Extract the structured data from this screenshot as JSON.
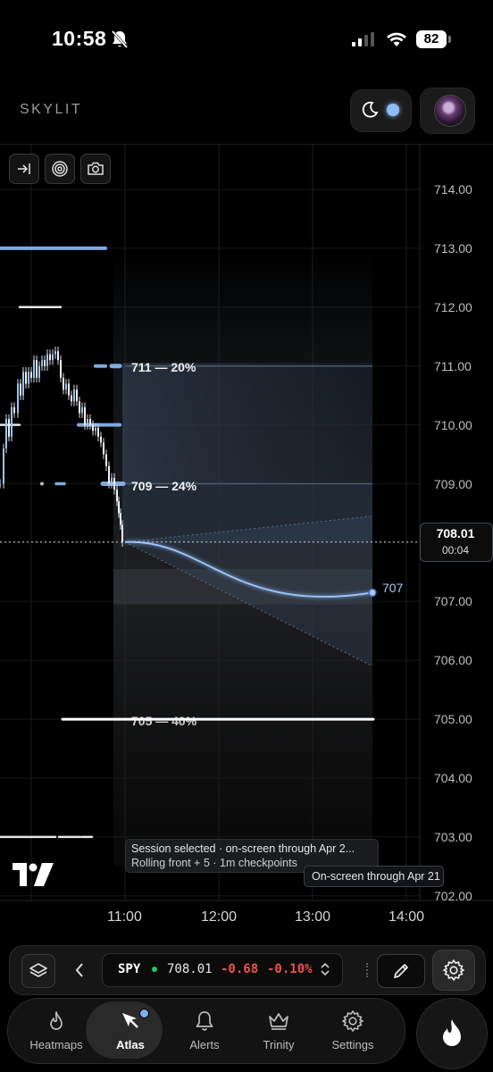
{
  "status_bar": {
    "time": "10:58",
    "battery": "82"
  },
  "header": {
    "brand": "SKYLIT"
  },
  "colors": {
    "accent": "#8ebcf5",
    "negative": "#ef5350",
    "live": "#22c55e"
  },
  "icons": [
    "bell-slash-icon",
    "signal-icon",
    "wifi-icon",
    "moon-icon",
    "jump-to-end-icon",
    "target-icon",
    "camera-icon",
    "tradingview-logo",
    "layers-icon",
    "chevron-left-icon",
    "up-down-chevron-icon",
    "pencil-icon",
    "gear-icon",
    "flame-icon",
    "atlas-icon",
    "bell-icon",
    "crown-icon"
  ],
  "chart": {
    "y_labels": [
      "714.00",
      "713.00",
      "712.00",
      "711.00",
      "710.00",
      "709.00",
      "708.00",
      "707.00",
      "706.00",
      "705.00",
      "704.00",
      "703.00",
      "702.00"
    ],
    "x_labels": [
      "11:00",
      "12:00",
      "13:00",
      "14:00"
    ],
    "current_price": "708.01",
    "countdown": "00:04",
    "levels": [
      {
        "label": "711 — 20%"
      },
      {
        "label": "709 — 24%"
      },
      {
        "label": "705 — 40%"
      }
    ],
    "projection_label": "707",
    "tooltip": {
      "line1": "Session selected · on-screen through Apr 2...",
      "line2": "Rolling front + 5 · 1m checkpoints"
    },
    "range_tag": "On-screen through Apr 21"
  },
  "chart_data": {
    "type": "candlestick",
    "x": [
      "11:00",
      "12:00",
      "13:00",
      "14:00"
    ],
    "ylim": [
      702,
      714.3
    ],
    "last_price": 708.01,
    "levels": [
      {
        "price": 711,
        "prob": 20
      },
      {
        "price": 709,
        "prob": 24
      },
      {
        "price": 705,
        "prob": 40
      }
    ],
    "projection_end": 707.15,
    "grid": true
  },
  "ticker": {
    "symbol": "SPY",
    "price": "708.01",
    "change": "-0.68",
    "change_pct": "-0.10%"
  },
  "nav": {
    "items": [
      {
        "label": "Heatmaps"
      },
      {
        "label": "Atlas"
      },
      {
        "label": "Alerts"
      },
      {
        "label": "Trinity"
      },
      {
        "label": "Settings"
      }
    ],
    "active": "Atlas"
  }
}
